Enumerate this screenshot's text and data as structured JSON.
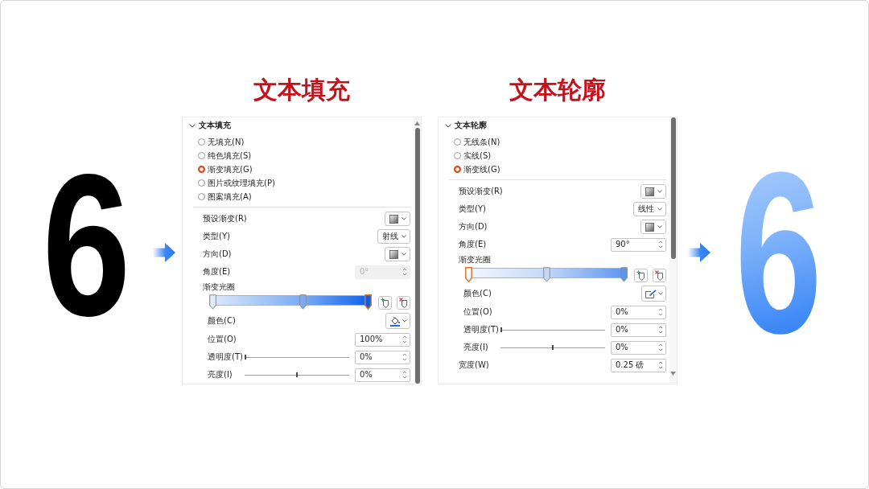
{
  "before_digit": {
    "text": "6"
  },
  "panels": [
    {
      "kind": "fill",
      "heading": "文本填充",
      "section": {
        "label": "文本填充",
        "expanded": true
      },
      "options": [
        {
          "label": "无填充(N)",
          "selected": false
        },
        {
          "label": "纯色填充(S)",
          "selected": false
        },
        {
          "label": "渐变填充(G)",
          "selected": true
        },
        {
          "label": "图片或纹理填充(P)",
          "selected": false
        },
        {
          "label": "图案填充(A)",
          "selected": false
        }
      ],
      "rows": [
        {
          "kind": "dropdown",
          "label": "预设渐变(R)",
          "disabled": false
        },
        {
          "kind": "dropdown",
          "label": "类型(Y)",
          "value": "射线",
          "disabled": false
        },
        {
          "kind": "dropdown",
          "label": "方向(D)",
          "disabled": false
        },
        {
          "kind": "spinner",
          "label": "角度(E)",
          "value": "0°",
          "disabled": true
        },
        {
          "kind": "stops",
          "label": "渐变光圈",
          "disabled": false,
          "stops": [
            {
              "level": 0,
              "color": "#dfeafc",
              "selected": false
            },
            {
              "level": 0.58,
              "color": "#78abf4",
              "selected": false
            },
            {
              "level": 1,
              "color": "#0b5ee8",
              "selected": true
            }
          ],
          "children": [
            {
              "kind": "color",
              "label": "颜色(C)",
              "disabled": false
            },
            {
              "kind": "spinner",
              "label": "位置(O)",
              "value": "100%",
              "disabled": false
            },
            {
              "kind": "slider",
              "label": "透明度(T)",
              "level": 0,
              "value": "0%",
              "disabled": false
            },
            {
              "kind": "slider",
              "label": "亮度(I)",
              "level": 0.5,
              "value": "0%",
              "disabled": false
            }
          ]
        }
      ]
    },
    {
      "kind": "outline",
      "heading": "文本轮廓",
      "section": {
        "label": "文本轮廓",
        "expanded": true
      },
      "options": [
        {
          "label": "无线条(N)",
          "selected": false
        },
        {
          "label": "实线(S)",
          "selected": false
        },
        {
          "label": "渐变线(G)",
          "selected": true
        }
      ],
      "rows": [
        {
          "kind": "dropdown",
          "label": "预设渐变(R)",
          "disabled": false
        },
        {
          "kind": "dropdown",
          "label": "类型(Y)",
          "value": "线性",
          "disabled": false
        },
        {
          "kind": "dropdown",
          "label": "方向(D)",
          "disabled": false
        },
        {
          "kind": "spinner",
          "label": "角度(E)",
          "value": "90°",
          "disabled": false
        },
        {
          "kind": "stops",
          "label": "渐变光圈",
          "disabled": false,
          "stops": [
            {
              "level": 0,
              "color": "#f5f8fe",
              "selected": true
            },
            {
              "level": 0.5,
              "color": "#c3d8f8",
              "selected": false
            },
            {
              "level": 1,
              "color": "#5b94ee",
              "selected": false
            }
          ],
          "children": [
            {
              "kind": "color",
              "label": "颜色(C)",
              "disabled": false
            },
            {
              "kind": "spinner",
              "label": "位置(O)",
              "value": "0%",
              "disabled": false
            },
            {
              "kind": "slider",
              "label": "透明度(T)",
              "level": 0,
              "value": "0%",
              "disabled": false
            },
            {
              "kind": "slider",
              "label": "亮度(I)",
              "level": 0.5,
              "value": "0%",
              "disabled": false
            }
          ]
        },
        {
          "kind": "spinner",
          "label": "宽度(W)",
          "value": "0.25 磅",
          "disabled": false
        }
      ]
    }
  ],
  "after_digit": {
    "text": "6"
  }
}
